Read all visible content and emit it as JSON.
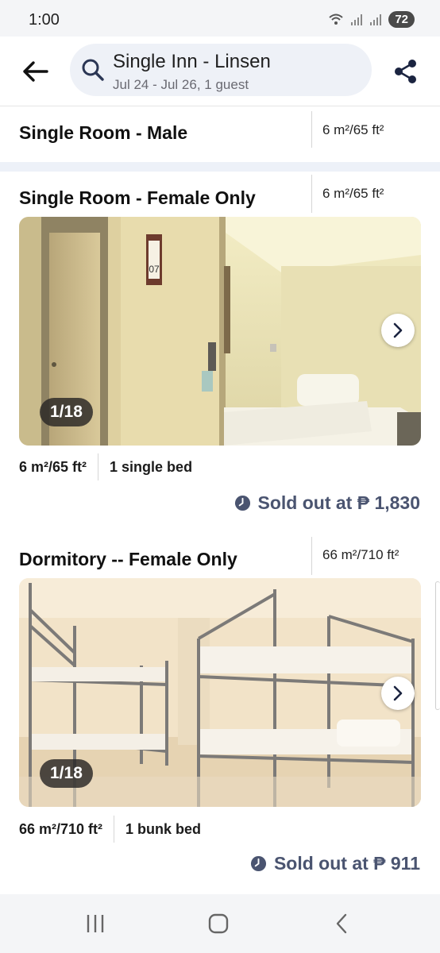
{
  "status_bar": {
    "time": "1:00",
    "battery": "72"
  },
  "header": {
    "hotel_name": "Single Inn - Linsen",
    "dates_guests": "Jul 24 - Jul 26, 1 guest"
  },
  "rooms": [
    {
      "name": "Single Room - Male",
      "size": "6 m²/65 ft²"
    },
    {
      "name": "Single Room - Female Only",
      "size": "6 m²/65 ft²",
      "photo_counter": "1/18",
      "spec_size": "6 m²/65 ft²",
      "bed": "1 single bed",
      "price_status": "Sold out at ₱ 1,830",
      "door_number": "07"
    },
    {
      "name": "Dormitory -- Female Only",
      "size": "66 m²/710 ft²",
      "photo_counter": "1/18",
      "spec_size": "66 m²/710 ft²",
      "bed": "1 bunk bed",
      "price_status": "Sold out at ₱ 911"
    }
  ],
  "icons": {
    "back": "back-arrow-icon",
    "search": "search-icon",
    "share": "share-icon",
    "next": "chevron-right-icon",
    "sold_out": "clock-icon",
    "nav_recents": "recents-icon",
    "nav_home": "home-icon",
    "nav_back": "back-chevron-icon"
  },
  "colors": {
    "accent": "#4a5470",
    "search_bg": "#eef1f7",
    "section_gap": "#edf1f8"
  }
}
